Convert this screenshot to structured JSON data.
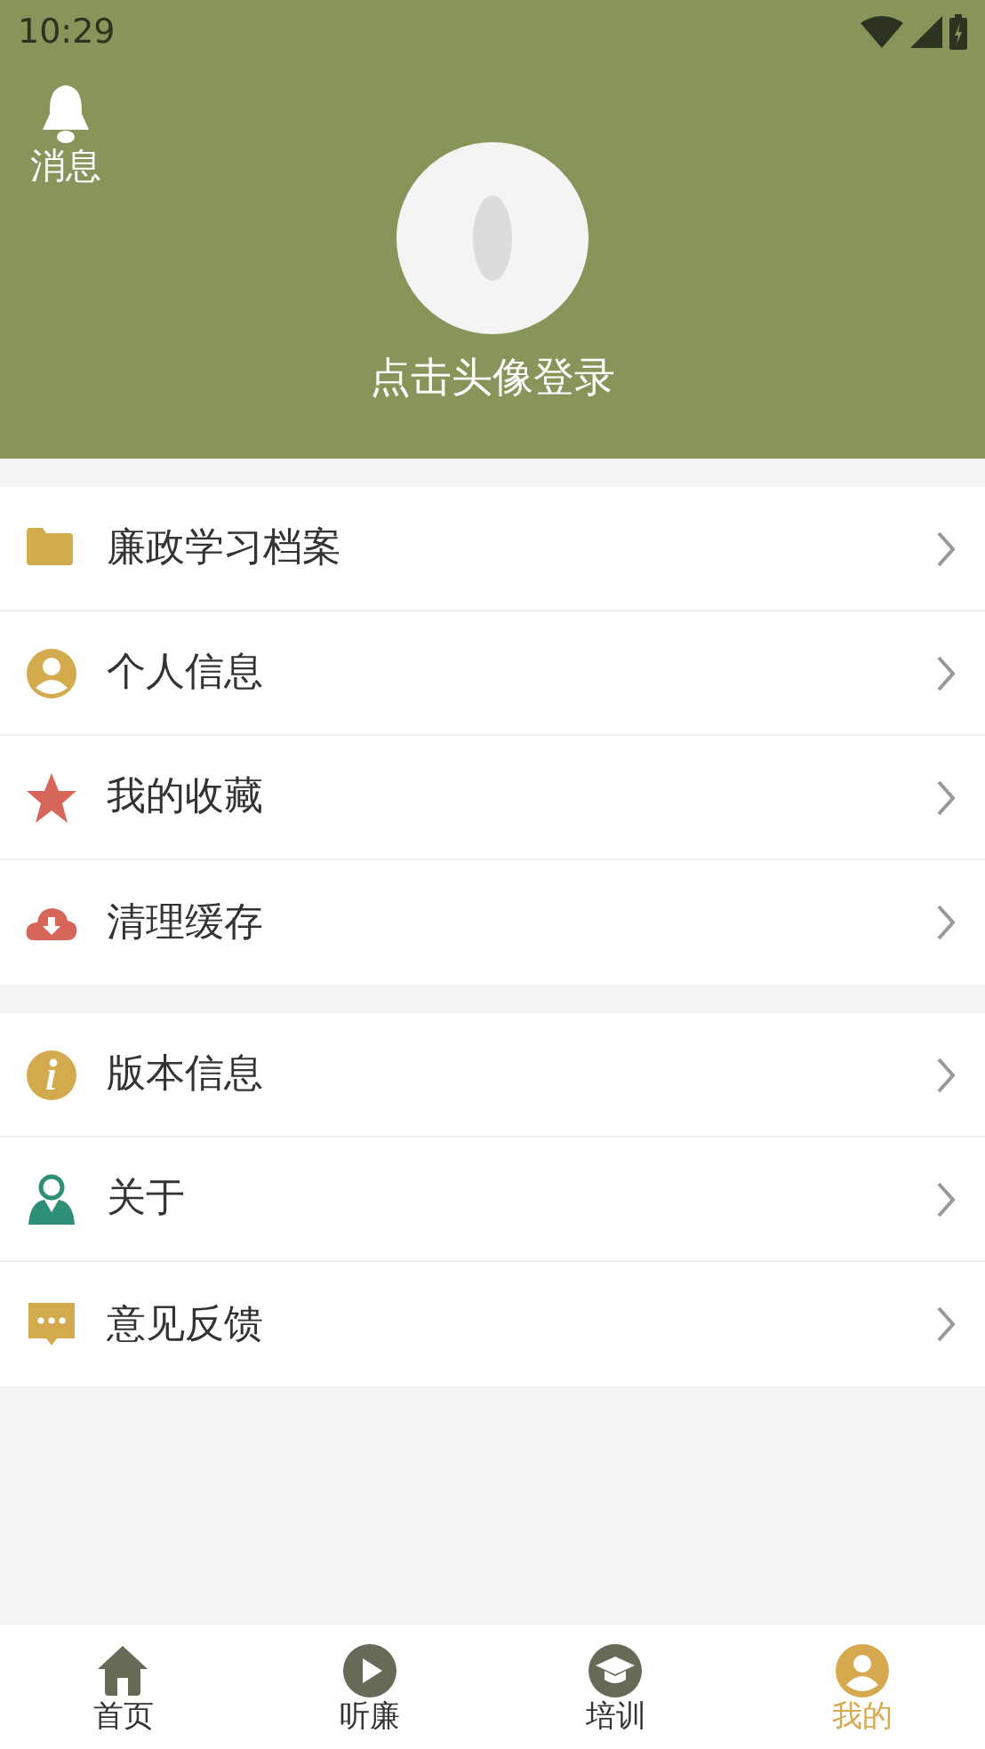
{
  "status_bar": {
    "time": "10:29"
  },
  "header": {
    "message_label": "消息",
    "login_prompt": "点击头像登录"
  },
  "menu_groups": [
    {
      "items": [
        {
          "label": "廉政学习档案",
          "kind": "folder"
        },
        {
          "label": "个人信息",
          "kind": "person"
        },
        {
          "label": "我的收藏",
          "kind": "star"
        },
        {
          "label": "清理缓存",
          "kind": "cloud"
        }
      ]
    },
    {
      "items": [
        {
          "label": "版本信息",
          "kind": "info"
        },
        {
          "label": "关于",
          "kind": "about"
        },
        {
          "label": "意见反馈",
          "kind": "feedback"
        }
      ]
    }
  ],
  "bottom_nav": [
    {
      "label": "首页",
      "kind": "home",
      "selected": false
    },
    {
      "label": "听廉",
      "kind": "play",
      "selected": false
    },
    {
      "label": "培训",
      "kind": "training",
      "selected": false
    },
    {
      "label": "我的",
      "kind": "profile",
      "selected": true
    }
  ]
}
